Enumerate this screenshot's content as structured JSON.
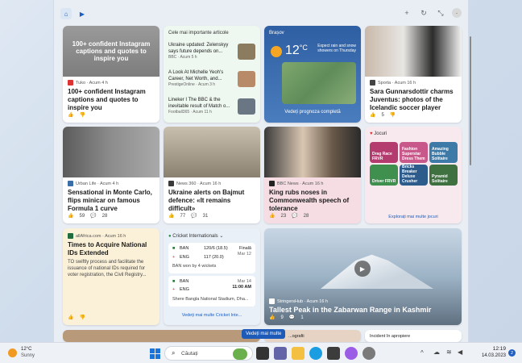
{
  "toolbar": {
    "home_icon": "home-icon",
    "video_icon": "video-icon",
    "right_icons": [
      "plus-icon",
      "refresh-icon",
      "collapse-icon",
      "profile-icon"
    ]
  },
  "cards": {
    "instagram": {
      "overlay": "100+ confident Instagram captions and quotes to inspire you",
      "source": "Tuko · Acum 4 h",
      "title": "100+ confident Instagram captions and quotes to inspire you"
    },
    "top_stories": {
      "header": "Cele mai importante articole",
      "items": [
        {
          "text": "Ukraine updated: Zelenskyy says future depends on...",
          "source": "BBC · Acum 5 h"
        },
        {
          "text": "A Look At Michelle Yeoh's Career, Net Worth, and...",
          "source": "PrestigeOnline · Acum 3 h"
        },
        {
          "text": "Lineker I The BBC & the inevitable result of Match o...",
          "source": "Football365 · Acum 11 h"
        }
      ]
    },
    "weather": {
      "location": "Brașov",
      "temp": "12",
      "unit": "°C",
      "note": "Expect rain and snow showers on Thursday",
      "link": "Vedeți prognoza completă"
    },
    "sara": {
      "source": "Sporta · Acum 16 h",
      "title": "Sara Gunnarsdottir charms Juventus: photos of the Icelandic soccer player",
      "likes": "5"
    },
    "monte": {
      "source": "Urban Life · Acum 4 h",
      "title": "Sensational in Monte Carlo, flips minicar on famous Formula 1 curve",
      "likes": "59",
      "comments": "28"
    },
    "bajmut": {
      "source": "News 360 · Acum 16 h",
      "title": "Ukraine alerts on Bajmut defence: «It remains difficult»",
      "likes": "77",
      "comments": "31"
    },
    "king": {
      "source": "BBC News · Acum 16 h",
      "title": "King rubs noses in Commonwealth speech of tolerance",
      "likes": "23",
      "comments": "28"
    },
    "games": {
      "header": "Jocuri",
      "tiles": [
        "Drag Race FRVR",
        "Fashion Superstar Dress Them",
        "Driver FRVR",
        "Amazing Bubble Solitaire",
        "Bricks Breaker Deluxe Crusher",
        "Pyramid Solitaire"
      ],
      "link": "Explorați mai multe jocuri"
    },
    "ids": {
      "source": "allAfrica.com · Acum 16 h",
      "title": "Times to Acquire National IDs Extended",
      "body": "TO swiftly process and facilitate the issuance of national IDs required for voter registration, the Civil Registry..."
    },
    "cricket": {
      "header": "Cricket Internationals",
      "m1": {
        "t1": "BAN",
        "s1": "120/6 (18.5)",
        "t2": "ENG",
        "s2": "117 (20.0)",
        "status": "Finală",
        "date": "Mar 12",
        "result": "BAN won by 4 wickets"
      },
      "m2": {
        "t1": "BAN",
        "t2": "ENG",
        "date": "Mar 14",
        "time": "11:00 AM",
        "venue": "Shere Bangla National Stadium, Dha..."
      },
      "link": "Vedeți mai multe Cricket Inte..."
    },
    "kashmir": {
      "source": "StringersHub · Acum 16 h",
      "title": "Tallest Peak in the Zabarwan Range in Kashmir",
      "likes": "9",
      "comments": "1"
    },
    "bottom": {
      "mid": "...ografii",
      "right": "Incident în apropiere"
    }
  },
  "tooltip": "Vedeți mai multe",
  "taskbar": {
    "weather_temp": "12°C",
    "weather_desc": "Sunny",
    "search": "Căutați",
    "time": "12:19",
    "date": "14.03.2023",
    "badge": "2"
  }
}
